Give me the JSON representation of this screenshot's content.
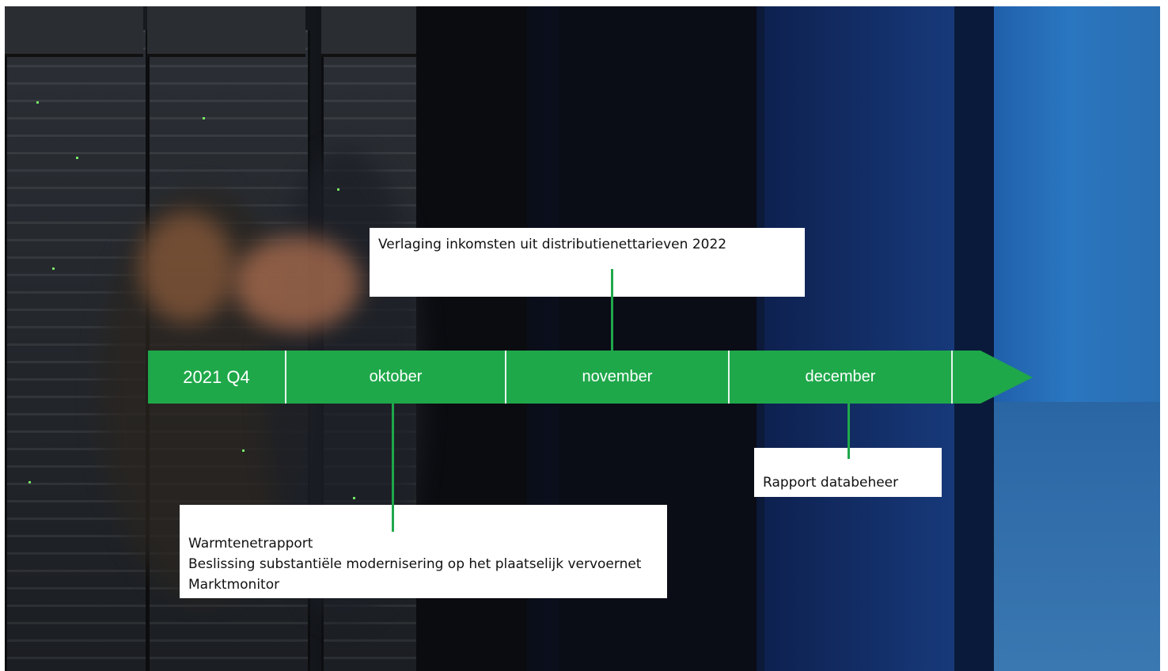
{
  "timeline": {
    "period_label": "2021 Q4",
    "months": [
      "oktober",
      "november",
      "december"
    ],
    "color": "#1fa84a"
  },
  "events": {
    "november": {
      "lines": [
        "Verlaging inkomsten uit distributienettarieven 2022"
      ]
    },
    "oktober": {
      "lines": [
        "Warmtenetrapport",
        "Beslissing substantiële modernisering op het plaatselijk vervoernet",
        "Marktmonitor"
      ]
    },
    "december": {
      "lines": [
        "Rapport databeheer"
      ]
    }
  }
}
